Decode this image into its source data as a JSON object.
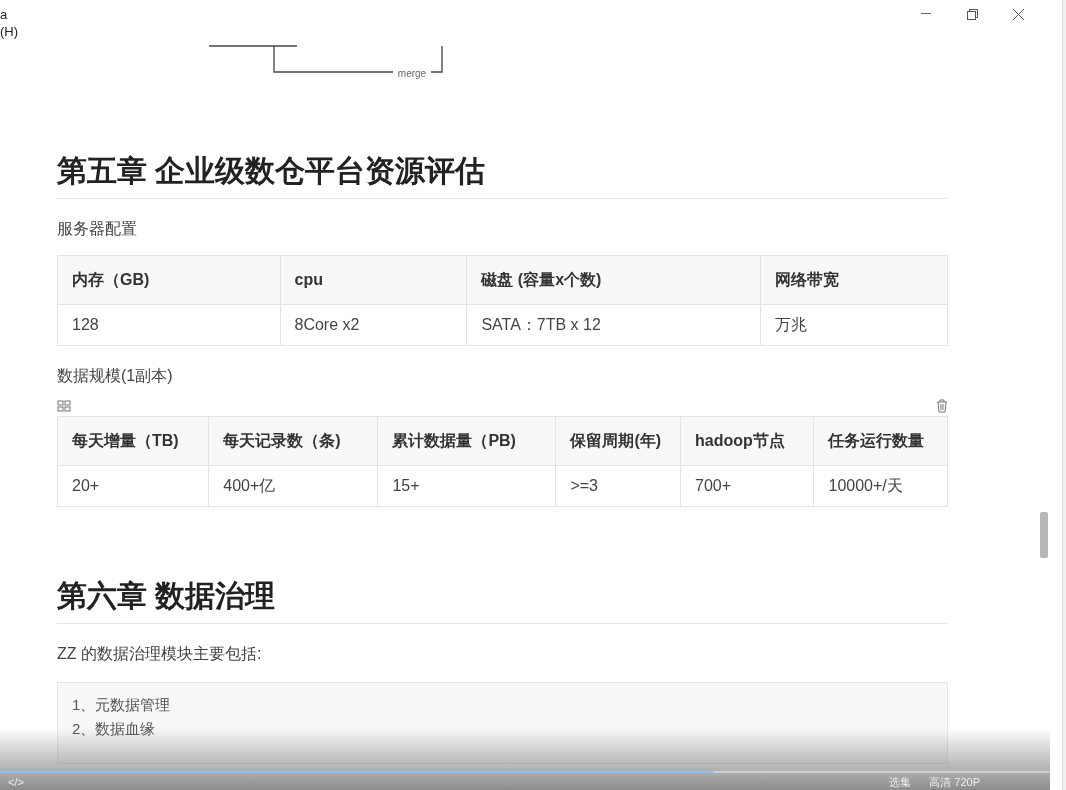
{
  "window": {
    "title_fragment": "a",
    "menu_fragment": "(H)"
  },
  "diagram": {
    "label": "merge"
  },
  "chapters": [
    {
      "heading": "第五章 企业级数仓平台资源评估",
      "blocks": [
        {
          "kind": "paragraph",
          "text": "服务器配置"
        },
        {
          "kind": "table",
          "tools": false,
          "columns": [
            "内存（GB)",
            "cpu",
            "磁盘 (容量x个数)",
            "网络带宽"
          ],
          "rows": [
            [
              "128",
              "8Core x2",
              "SATA：7TB x 12",
              "万兆"
            ]
          ]
        },
        {
          "kind": "paragraph",
          "text": "数据规模(1副本)"
        },
        {
          "kind": "table",
          "tools": true,
          "columns": [
            "每天增量（TB)",
            "每天记录数（条)",
            "累计数据量（PB)",
            "保留周期(年)",
            "hadoop节点",
            "任务运行数量"
          ],
          "rows": [
            [
              "20+",
              "400+亿",
              "15+",
              ">=3",
              "700+",
              "10000+/天"
            ]
          ]
        }
      ]
    },
    {
      "heading": "第六章 数据治理",
      "blocks": [
        {
          "kind": "paragraph",
          "text": "ZZ 的数据治理模块主要包括:"
        },
        {
          "kind": "code",
          "lines": [
            "1、元数据管理",
            "2、数据血缘"
          ]
        }
      ]
    }
  ],
  "player": {
    "code_toggle": "</>",
    "progress": {
      "level": 0.68
    },
    "controls": [
      "选集",
      "高清 720P"
    ]
  }
}
